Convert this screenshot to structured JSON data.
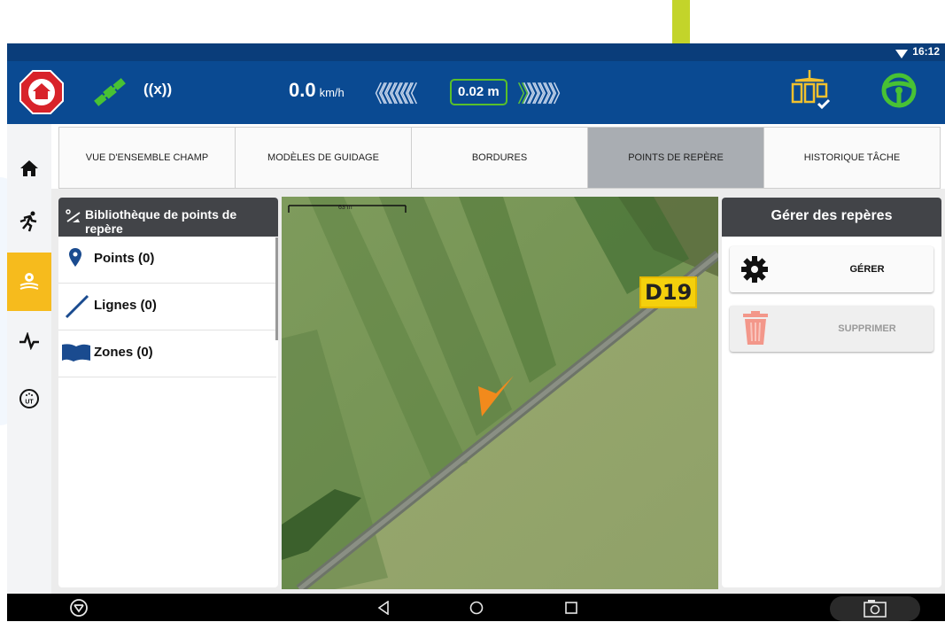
{
  "status_bar": {
    "time": "16:12"
  },
  "header": {
    "speed_value": "0.0",
    "speed_unit": "km/h",
    "accuracy": "0.02 m",
    "radio_text": "((x))"
  },
  "left_nav": {
    "items": [
      {
        "icon": "home-icon",
        "active": false
      },
      {
        "icon": "runner-icon",
        "active": false
      },
      {
        "icon": "field-gear-icon",
        "active": true
      },
      {
        "icon": "pulse-icon",
        "active": false
      },
      {
        "icon": "ut-icon",
        "active": false
      }
    ],
    "ut_label": "UT"
  },
  "tabs": [
    {
      "label": "VUE D'ENSEMBLE CHAMP",
      "active": false
    },
    {
      "label": "MODÈLES DE GUIDAGE",
      "active": false
    },
    {
      "label": "BORDURES",
      "active": false
    },
    {
      "label": "POINTS DE REPÈRE",
      "active": true
    },
    {
      "label": "HISTORIQUE TÂCHE",
      "active": false
    }
  ],
  "library": {
    "title": "Bibliothèque de points de repère",
    "items": [
      {
        "label": "Points (0)",
        "icon": "pin-icon"
      },
      {
        "label": "Lignes (0)",
        "icon": "line-icon"
      },
      {
        "label": "Zones (0)",
        "icon": "zone-icon"
      }
    ]
  },
  "map": {
    "scale_label": "63 m",
    "road_label": "D19"
  },
  "manage": {
    "title": "Gérer des repères",
    "manage_label": "GÉRER",
    "delete_label": "SUPPRIMER"
  },
  "colors": {
    "header": "#0a4a92",
    "accent_active": "#f6bb1d",
    "annotation_arrow": "#c3d42a",
    "vehicle_marker": "#f28a1c",
    "delete_icon": "#f3978a"
  }
}
